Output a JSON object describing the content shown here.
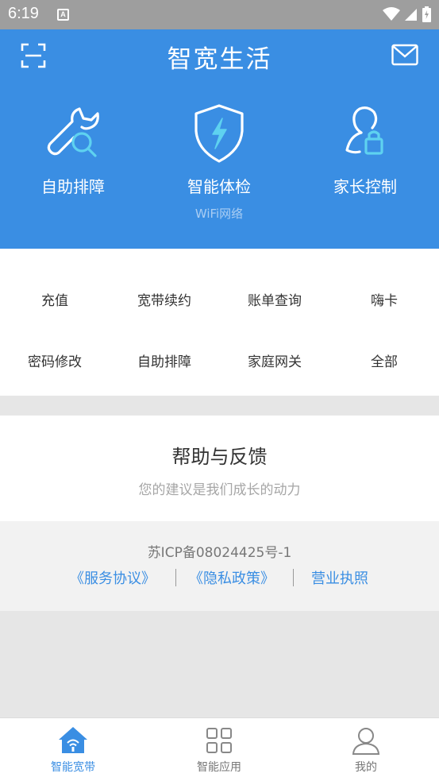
{
  "status": {
    "time": "6:19",
    "notif_letter": "A"
  },
  "header": {
    "title": "智宽生活",
    "features": [
      {
        "label": "自助排障",
        "sub": ""
      },
      {
        "label": "智能体检",
        "sub": "WiFi网络"
      },
      {
        "label": "家长控制",
        "sub": ""
      }
    ]
  },
  "quick_menu": [
    {
      "label": "充值"
    },
    {
      "label": "宽带续约"
    },
    {
      "label": "账单查询"
    },
    {
      "label": "嗨卡"
    },
    {
      "label": "密码修改"
    },
    {
      "label": "自助排障"
    },
    {
      "label": "家庭网关"
    },
    {
      "label": "全部"
    }
  ],
  "help": {
    "title": "帮助与反馈",
    "subtitle": "您的建议是我们成长的动力"
  },
  "footer": {
    "icp": "苏ICP备08024425号-1",
    "links": [
      "《服务协议》",
      "《隐私政策》",
      "营业执照"
    ]
  },
  "tabs": [
    {
      "label": "智能宽带"
    },
    {
      "label": "智能应用"
    },
    {
      "label": "我的"
    }
  ],
  "colors": {
    "primary": "#3a8ee3",
    "accent_cyan": "#5ed2f0",
    "status_bar": "#9e9e9e"
  }
}
